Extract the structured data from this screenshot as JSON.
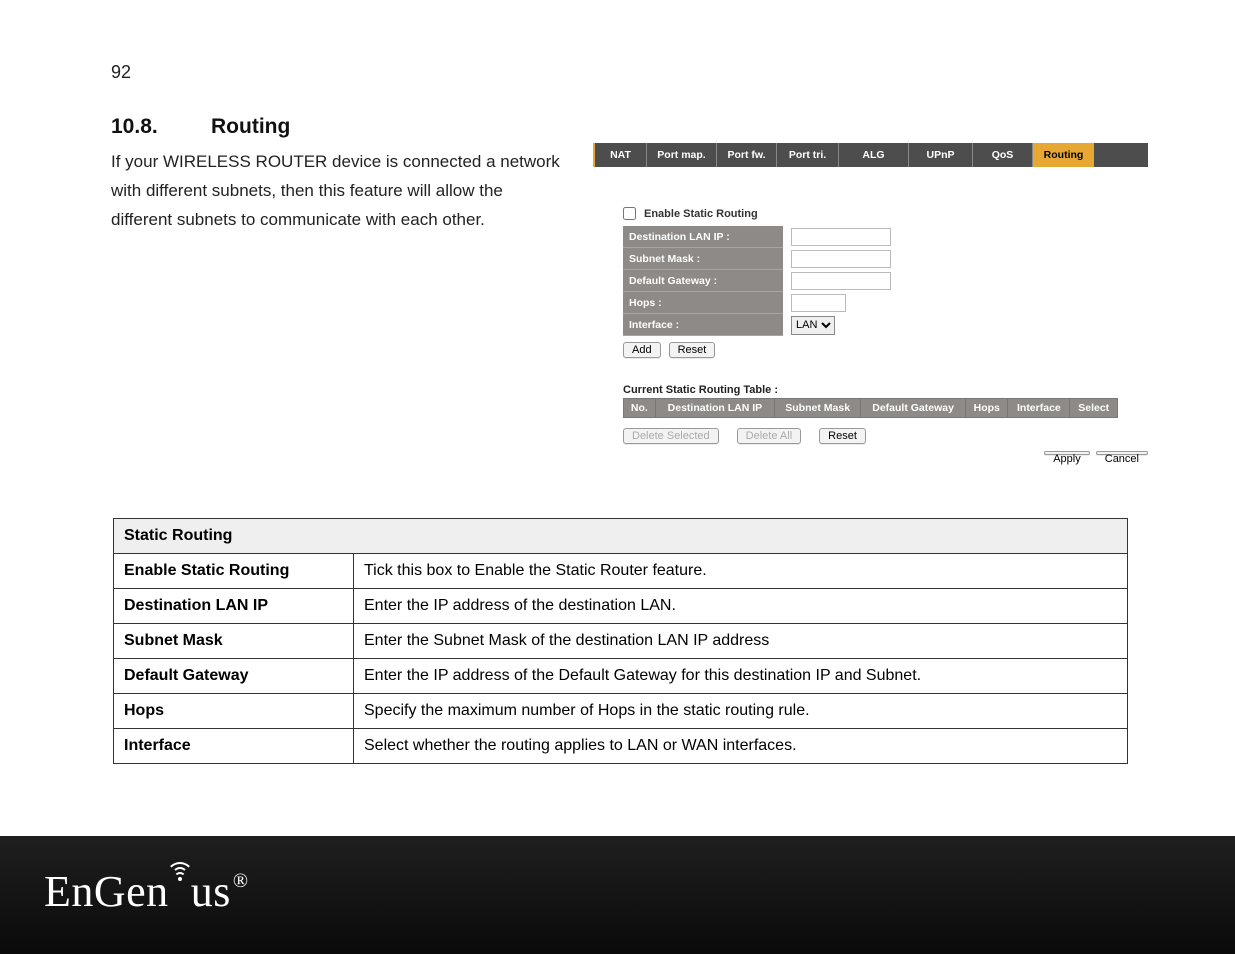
{
  "page_number": "92",
  "section": {
    "number": "10.8.",
    "title": "Routing"
  },
  "intro": "If your WIRELESS ROUTER device is connected a network with different subnets, then this feature will allow the different subnets to communicate with each other.",
  "router_ui": {
    "tabs": [
      "NAT",
      "Port map.",
      "Port fw.",
      "Port tri.",
      "ALG",
      "UPnP",
      "QoS",
      "Routing"
    ],
    "active_tab_index": 7,
    "enable_label": "Enable Static Routing",
    "fields": {
      "dest_lan_ip": {
        "label": "Destination LAN IP :",
        "value": ""
      },
      "subnet_mask": {
        "label": "Subnet Mask :",
        "value": ""
      },
      "default_gateway": {
        "label": "Default Gateway :",
        "value": ""
      },
      "hops": {
        "label": "Hops :",
        "value": ""
      },
      "interface": {
        "label": "Interface :",
        "selected": "LAN"
      }
    },
    "buttons": {
      "add": "Add",
      "reset": "Reset",
      "delete_selected": "Delete Selected",
      "delete_all": "Delete All",
      "reset2": "Reset",
      "apply": "Apply",
      "cancel": "Cancel"
    },
    "table_title": "Current Static Routing Table :",
    "table_headers": [
      "No.",
      "Destination LAN IP",
      "Subnet Mask",
      "Default Gateway",
      "Hops",
      "Interface",
      "Select"
    ]
  },
  "def_table": {
    "header": "Static Routing",
    "rows": [
      {
        "label": "Enable Static Routing",
        "desc": "Tick this box to Enable the Static Router feature."
      },
      {
        "label": "Destination LAN IP",
        "desc": "Enter the IP address of the destination LAN."
      },
      {
        "label": "Subnet Mask",
        "desc": "Enter the Subnet Mask of the destination LAN IP address"
      },
      {
        "label": "Default Gateway",
        "desc": "Enter the IP address of the Default Gateway for this destination IP and Subnet."
      },
      {
        "label": "Hops",
        "desc": "Specify the maximum number of Hops in the static routing rule."
      },
      {
        "label": "Interface",
        "desc": "Select whether the routing applies to LAN or WAN interfaces."
      }
    ]
  },
  "brand": {
    "name_part1": "EnGen",
    "name_part2": "us",
    "reg": "®"
  }
}
